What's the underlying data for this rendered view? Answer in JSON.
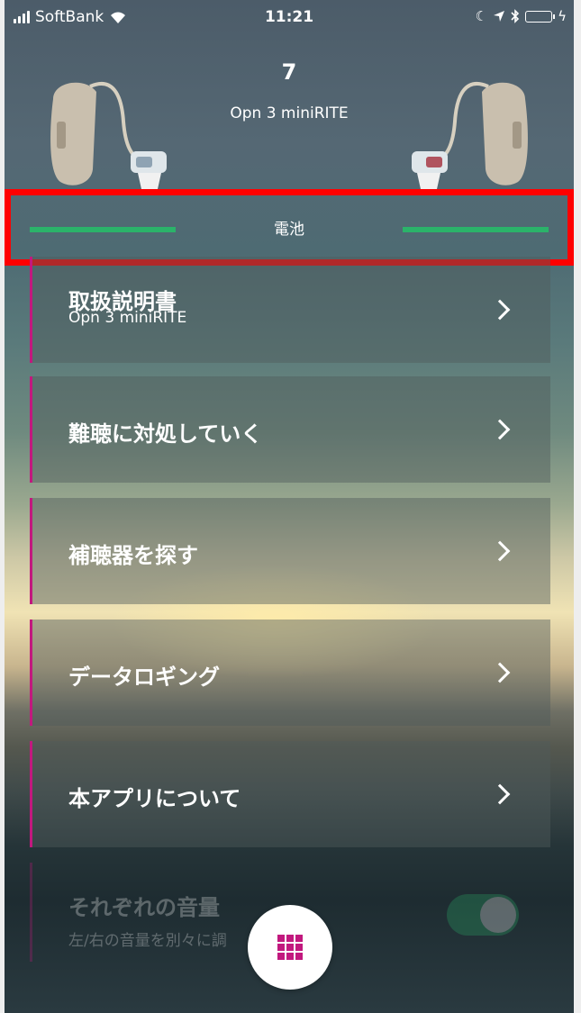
{
  "status_bar": {
    "carrier": "SoftBank",
    "time": "11:21"
  },
  "device": {
    "number": "7",
    "model": "Opn 3 miniRITE"
  },
  "battery": {
    "label": "電池",
    "left_level": 1.0,
    "right_level": 1.0,
    "bar_color": "#2bb36a"
  },
  "menu": [
    {
      "title": "取扱説明書",
      "subtitle": "Opn 3 miniRITE"
    },
    {
      "title": "難聴に対処していく"
    },
    {
      "title": "補聴器を探す"
    },
    {
      "title": "データロギング"
    },
    {
      "title": "本アプリについて"
    }
  ],
  "faded_setting": {
    "title": "それぞれの音量",
    "subtitle": "左/右の音量を別々に調"
  },
  "accent_color": "#c2187e",
  "icons": {
    "fab": "grid-menu-icon"
  }
}
